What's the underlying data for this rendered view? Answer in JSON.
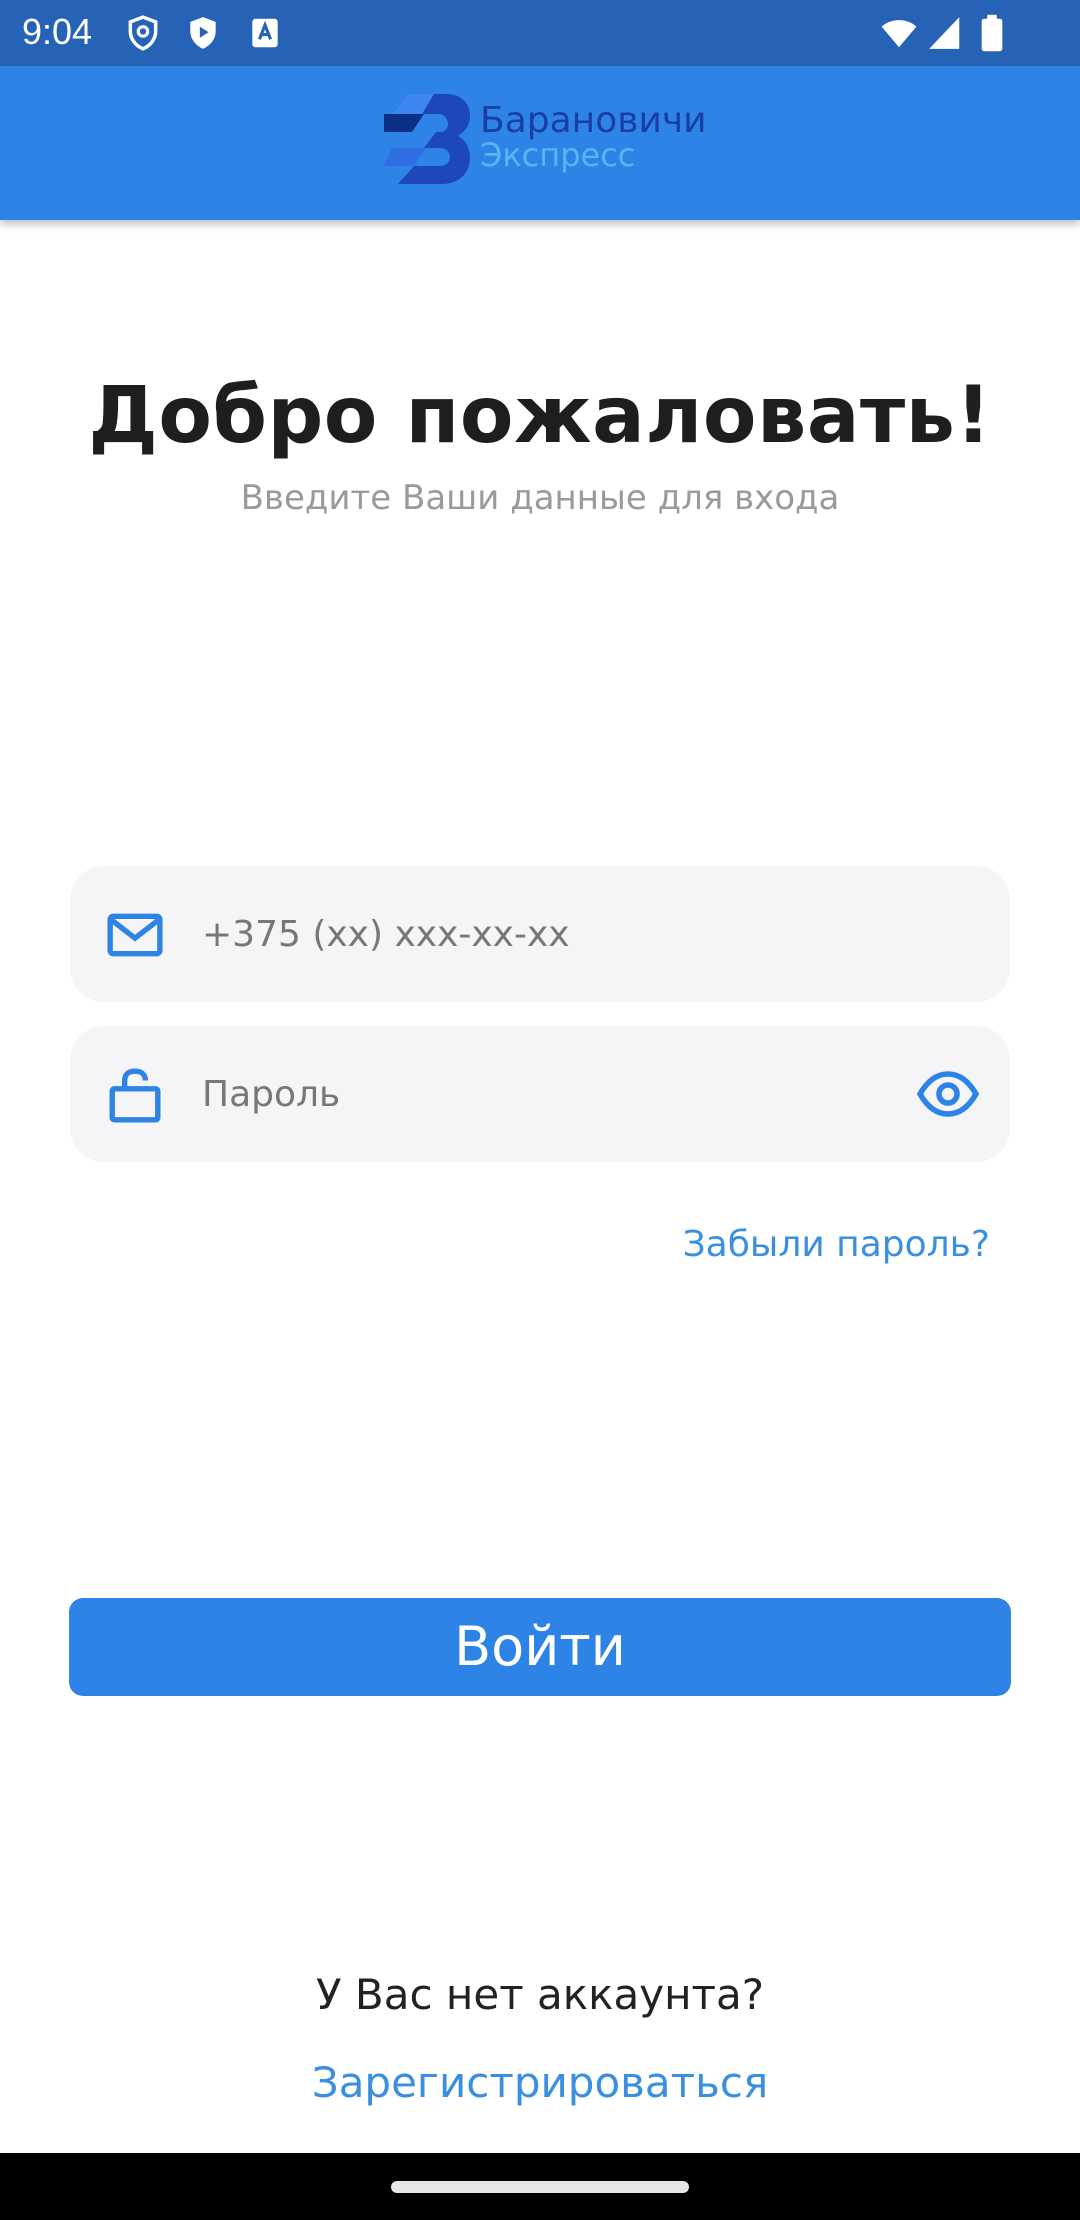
{
  "status_bar": {
    "time": "9:04",
    "icons": [
      "shield-icon",
      "play-store-icon",
      "font-icon",
      "wifi-icon",
      "signal-icon",
      "battery-icon"
    ]
  },
  "app_bar": {
    "logo_line1": "Барановичи",
    "logo_line2": "Экспресс",
    "logo_name": "baranovichi-express-logo"
  },
  "main": {
    "title": "Добро пожаловать!",
    "subtitle": "Введите Ваши данные для входа"
  },
  "form": {
    "phone_placeholder": "+375 (xx) xxx-xx-xx",
    "phone_value": "",
    "password_placeholder": "Пароль",
    "password_value": "",
    "forgot_label": "Забыли пароль?",
    "login_label": "Войти"
  },
  "footer": {
    "no_account": "У Вас нет аккаунта?",
    "register_label": "Зарегистрироваться"
  },
  "colors": {
    "status_bar": "#2663b6",
    "app_bar": "#2d84e6",
    "accent": "#2d84e6",
    "link": "#3a8fe0",
    "field_bg": "#f5f5f7"
  }
}
